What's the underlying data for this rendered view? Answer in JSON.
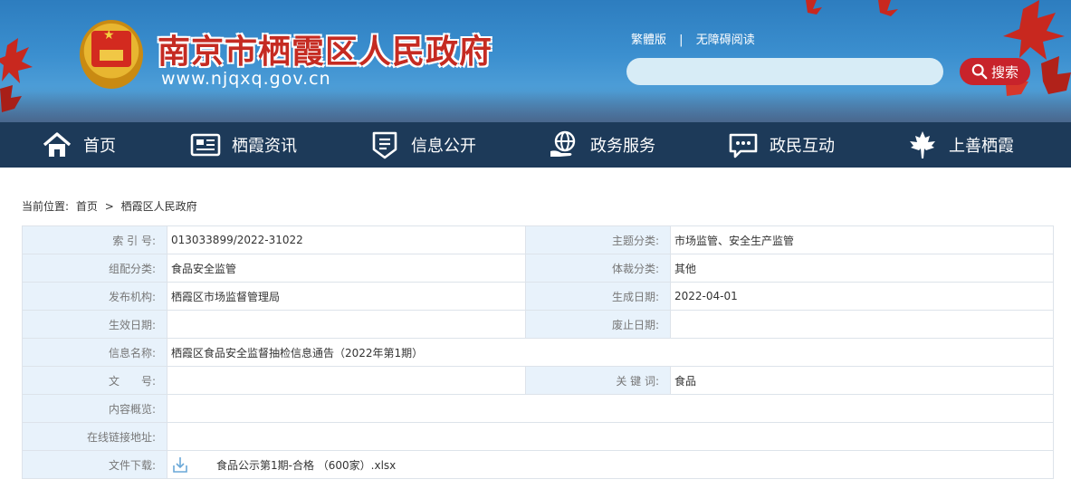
{
  "header": {
    "site_title": "南京市栖霞区人民政府",
    "site_url": "www.njqxq.gov.cn",
    "links": {
      "traditional": "繁體版",
      "accessible": "无障碍阅读"
    },
    "search": {
      "placeholder": "",
      "button_label": "搜索"
    }
  },
  "nav": {
    "items": [
      {
        "label": "首页",
        "icon": "home-icon"
      },
      {
        "label": "栖霞资讯",
        "icon": "news-icon"
      },
      {
        "label": "信息公开",
        "icon": "info-icon"
      },
      {
        "label": "政务服务",
        "icon": "service-icon"
      },
      {
        "label": "政民互动",
        "icon": "chat-icon"
      },
      {
        "label": "上善栖霞",
        "icon": "maple-leaf-icon"
      }
    ]
  },
  "breadcrumb": {
    "prefix": "当前位置:",
    "home": "首页",
    "sep": ">",
    "current": "栖霞区人民政府"
  },
  "meta": {
    "index_no": {
      "label": "索 引 号:",
      "value": "013033899/2022-31022"
    },
    "subject": {
      "label": "主题分类:",
      "value": "市场监管、安全生产监管"
    },
    "category": {
      "label": "组配分类:",
      "value": "食品安全监管"
    },
    "genre": {
      "label": "体裁分类:",
      "value": "其他"
    },
    "publisher": {
      "label": "发布机构:",
      "value": "栖霞区市场监督管理局"
    },
    "created": {
      "label": "生成日期:",
      "value": "2022-04-01"
    },
    "effective": {
      "label": "生效日期:",
      "value": ""
    },
    "expired": {
      "label": "废止日期:",
      "value": ""
    },
    "name": {
      "label": "信息名称:",
      "value": "栖霞区食品安全监督抽检信息通告（2022年第1期）"
    },
    "doc_no": {
      "label": "文　　号:",
      "value": ""
    },
    "keywords": {
      "label": "关 键 词:",
      "value": "食品"
    },
    "summary": {
      "label": "内容概览:",
      "value": ""
    },
    "online_link": {
      "label": "在线链接地址:",
      "value": ""
    },
    "download": {
      "label": "文件下载:",
      "file_name": "食品公示第1期-合格 （600家）.xlsx"
    }
  },
  "colors": {
    "nav_bg": "#1d3a59",
    "label_bg": "#e8f2fb",
    "title_red": "#c52b22",
    "search_red": "#c8232b"
  }
}
